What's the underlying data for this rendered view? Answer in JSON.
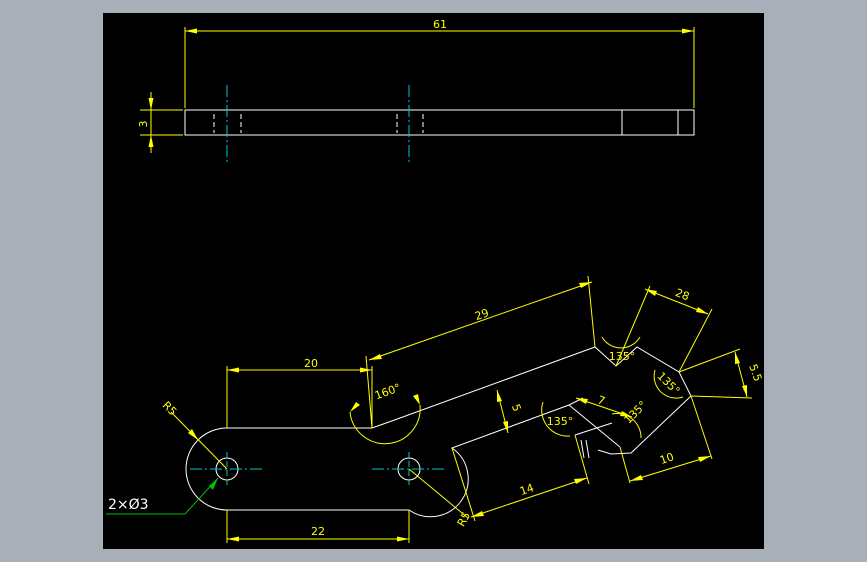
{
  "colors": {
    "background": "#a9afb9",
    "canvas": "#000000",
    "geometry": "#ffffff",
    "dimension": "#ffff00",
    "centerline": "#00c8c8",
    "leader": "#00c000"
  },
  "top_view": {
    "overall_length": "61",
    "thickness": "3"
  },
  "plan_view": {
    "dim_20": "20",
    "dim_22": "22",
    "dim_29": "29",
    "dim_28": "28",
    "dim_5_5": "5.5",
    "dim_5": "5",
    "dim_7": "7",
    "dim_14": "14",
    "dim_10": "10",
    "angle_160": "160°",
    "angle_135_a": "135°",
    "angle_135_b": "135°",
    "angle_135_c": "135°",
    "angle_135_d": "135°",
    "radius_left": "R5",
    "radius_right": "R5",
    "holes_callout": "2×Ø3"
  }
}
